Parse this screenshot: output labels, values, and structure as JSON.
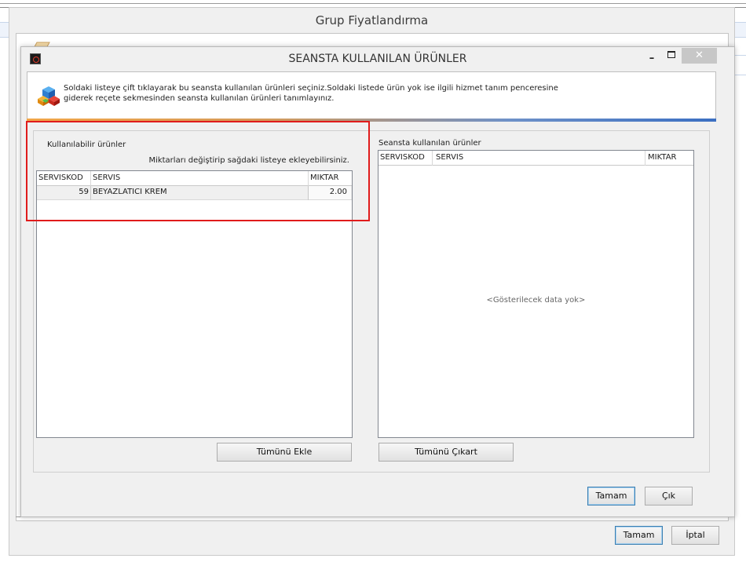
{
  "outer_window": {
    "title": "Grup Fiyatlandırma",
    "ok_label": "Tamam",
    "cancel_label": "İptal"
  },
  "modal": {
    "title": "SEANSTA KULLANILAN ÜRÜNLER",
    "minimize_glyph": "–",
    "close_glyph": "✕",
    "info_line1": "Soldaki listeye çift tıklayarak bu seansta kullanılan ürünleri seçiniz.Soldaki listede ürün yok ise ilgili hizmet tanım penceresine",
    "info_line2": "giderek reçete sekmesinden seansta kullanılan ürünleri tanımlayınız.",
    "ok_label": "Tamam",
    "exit_label": "Çık"
  },
  "available": {
    "label": "Kullanılabilir ürünler",
    "hint": "Miktarları değiştirip sağdaki listeye ekleyebilirsiniz.",
    "columns": [
      "SERVISKOD",
      "SERVIS",
      "MIKTAR"
    ],
    "rows": [
      {
        "code": "59",
        "service": "BEYAZLATICI KREM",
        "qty": "2.00"
      }
    ],
    "add_all_label": "Tümünü Ekle"
  },
  "used": {
    "label": "Seansta kullanılan ürünler",
    "columns": [
      "SERVISKOD",
      "SERVIS",
      "MIKTAR"
    ],
    "empty_message": "<Gösterilecek data yok>",
    "remove_all_label": "Tümünü Çıkart"
  },
  "colors": {
    "highlight": "#e01c1c",
    "primary_button_border": "#3c7fb1"
  }
}
